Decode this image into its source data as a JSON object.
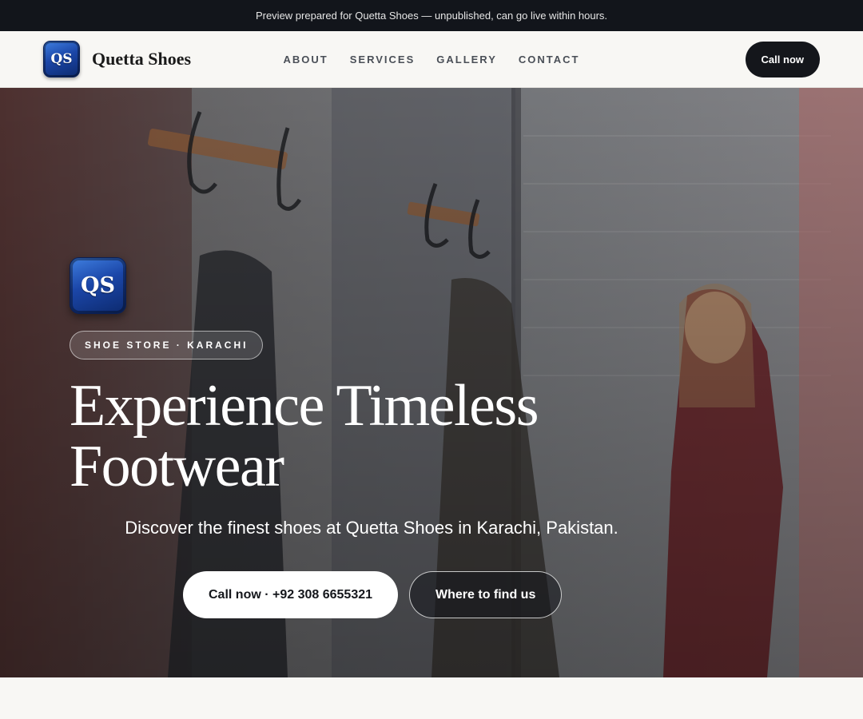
{
  "preview_bar": {
    "text": "Preview prepared for Quetta Shoes — unpublished, can go live within hours."
  },
  "brand": {
    "logo_text": "QS",
    "name": "Quetta Shoes"
  },
  "nav": {
    "items": [
      {
        "label": "ABOUT"
      },
      {
        "label": "SERVICES"
      },
      {
        "label": "GALLERY"
      },
      {
        "label": "CONTACT"
      }
    ],
    "cta_label": "Call now"
  },
  "hero": {
    "logo_text": "QS",
    "badge": "SHOE STORE · KARACHI",
    "headline": "Experience Timeless Footwear",
    "subtitle": "Discover the finest shoes at Quetta Shoes in Karachi, Pakistan.",
    "primary_cta": "Call now · +92 308 6655321",
    "secondary_cta": "Where to find us",
    "background_icon": "boutique-photo"
  },
  "colors": {
    "dark": "#12151b",
    "logo_blue": "#1b46a8",
    "page_bg": "#f8f7f4"
  }
}
